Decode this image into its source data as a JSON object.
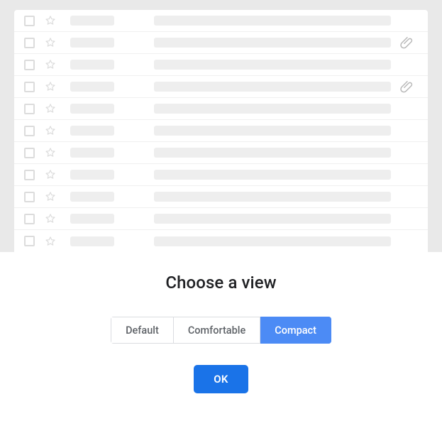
{
  "dialog": {
    "title": "Choose a view",
    "ok_label": "OK"
  },
  "density_options": [
    {
      "id": "default",
      "label": "Default",
      "selected": false
    },
    {
      "id": "comfortable",
      "label": "Comfortable",
      "selected": false
    },
    {
      "id": "compact",
      "label": "Compact",
      "selected": true
    }
  ],
  "preview_rows": [
    {
      "has_attachment": false
    },
    {
      "has_attachment": true
    },
    {
      "has_attachment": false
    },
    {
      "has_attachment": true
    },
    {
      "has_attachment": false
    },
    {
      "has_attachment": false
    },
    {
      "has_attachment": false
    },
    {
      "has_attachment": false
    },
    {
      "has_attachment": false
    },
    {
      "has_attachment": false
    },
    {
      "has_attachment": false
    }
  ]
}
